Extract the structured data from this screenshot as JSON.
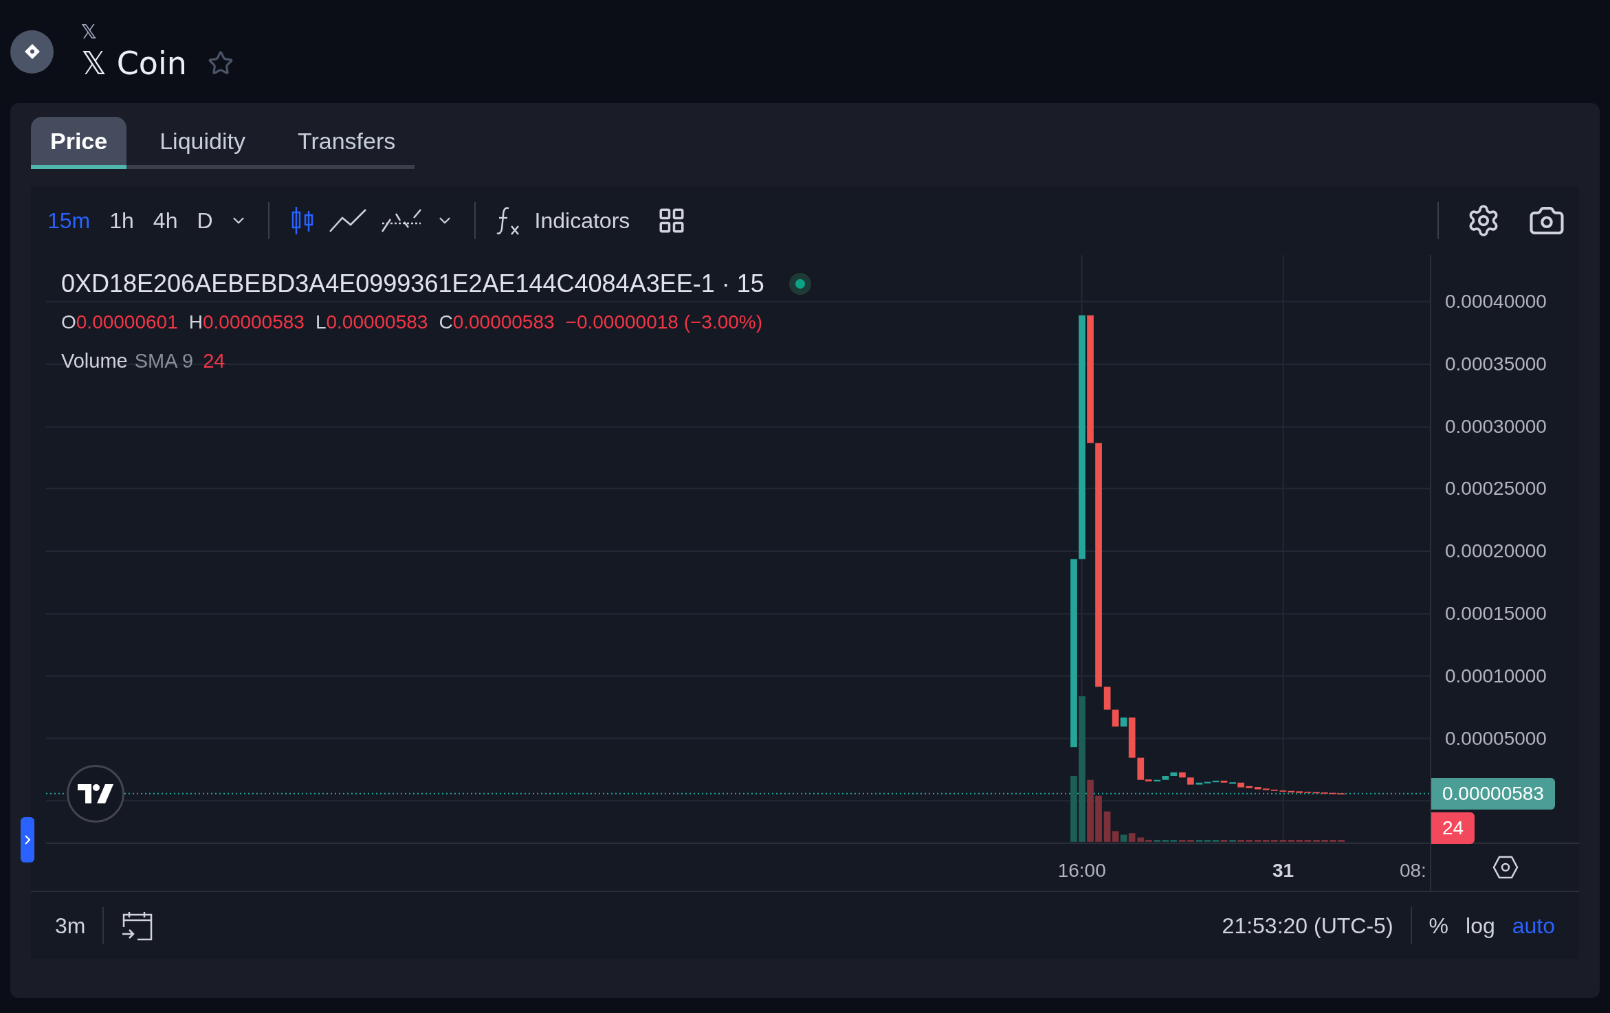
{
  "header": {
    "symbol": "𝕏",
    "title": "𝕏 Coin",
    "favorite": false
  },
  "tabs": [
    {
      "label": "Price",
      "selected": true
    },
    {
      "label": "Liquidity",
      "selected": false
    },
    {
      "label": "Transfers",
      "selected": false
    }
  ],
  "toolbar": {
    "intervals": [
      {
        "label": "15m",
        "selected": true
      },
      {
        "label": "1h",
        "selected": false
      },
      {
        "label": "4h",
        "selected": false
      },
      {
        "label": "D",
        "selected": false
      }
    ],
    "chart_types": [
      {
        "kind": "candles",
        "selected": true
      },
      {
        "kind": "line",
        "selected": false
      },
      {
        "kind": "baseline",
        "selected": false
      }
    ],
    "indicators": "Indicators"
  },
  "legend": {
    "symbol": "0XD18E206AEBEBD3A4E0999361E2AE144C4084A3EE-1 · 15",
    "ohlc": [
      {
        "key": "O",
        "value": "0.00000601"
      },
      {
        "key": "H",
        "value": "0.00000583"
      },
      {
        "key": "L",
        "value": "0.00000583"
      },
      {
        "key": "C",
        "value": "0.00000583"
      }
    ],
    "change": "−0.00000018 (−3.00%)",
    "volume": {
      "label": "Volume",
      "indicator": "SMA 9",
      "value": "24"
    }
  },
  "price_axis": {
    "ticks": [
      "0.00040000",
      "0.00035000",
      "0.00030000",
      "0.00025000",
      "0.00020000",
      "0.00015000",
      "0.00010000",
      "0.00005000"
    ],
    "last_price": "0.00000583",
    "last_volume": "24"
  },
  "time_axis": [
    {
      "label": "16:00",
      "kind": "time"
    },
    {
      "label": "31",
      "kind": "day"
    },
    {
      "label": "08:",
      "kind": "time"
    }
  ],
  "bottom_bar": {
    "range": "3m",
    "time": "21:53:20 (UTC-5)",
    "scale_options": [
      {
        "label": "%",
        "selected": false
      },
      {
        "label": "log",
        "selected": false
      },
      {
        "label": "auto",
        "selected": true
      }
    ]
  }
}
